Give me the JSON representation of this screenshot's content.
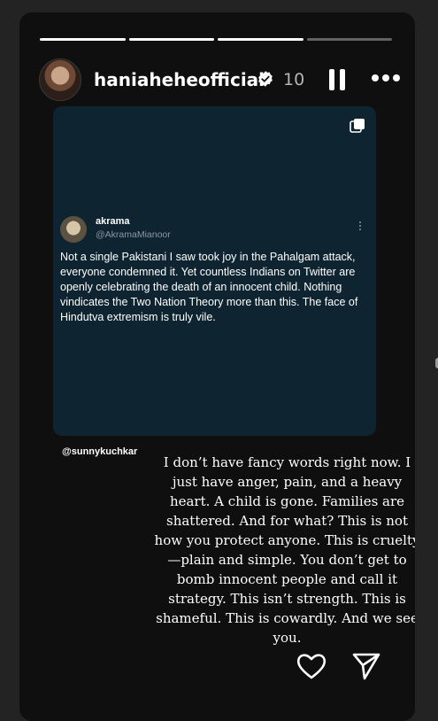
{
  "story": {
    "progress_segments": [
      1,
      1,
      1,
      0.0
    ],
    "username": "haniaheheofficial",
    "time": "10",
    "icons": {
      "avatar": "profile-photo",
      "verified": "verified-badge-icon",
      "pause": "pause-icon",
      "more": "more-horizontal-icon",
      "multi": "multiple-posts-icon",
      "like": "heart-icon",
      "share": "send-icon"
    }
  },
  "post": {
    "tweet": {
      "name": "akrama",
      "handle": "@AkramaMianoor",
      "text": "Not a single Pakistani I saw took joy in the Pahalgam attack, everyone condemned it. Yet countless Indians on Twitter are openly celebrating the death of an innocent child. Nothing vindicates the Two Nation Theory more than this. The face of Hindutva extremism is truly vile."
    },
    "mention": "@sunnykuchkar"
  },
  "caption": "I don’t have fancy words right now. I just have anger, pain, and a heavy heart. A child is gone. Families are shattered. And for what? This is not how you protect anyone. This is cruelty—plain and simple. You don’t get to bomb innocent people and call it strategy. This isn’t strength. This is shameful. This is cowardly. And we see you."
}
